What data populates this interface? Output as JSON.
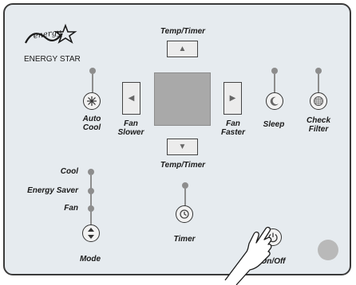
{
  "logo": {
    "text": "ENERGY STAR"
  },
  "buttons": {
    "temp_timer_up_label": "Temp/Timer",
    "temp_timer_down_label": "Temp/Timer",
    "auto_cool_label": "Auto\nCool",
    "fan_slower_label": "Fan\nSlower",
    "fan_faster_label": "Fan\nFaster",
    "sleep_label": "Sleep",
    "check_filter_label": "Check\nFilter",
    "timer_label": "Timer",
    "mode_label": "Mode",
    "on_off_label": "On/Off"
  },
  "mode_options": [
    {
      "label": "Cool"
    },
    {
      "label": "Energy Saver"
    },
    {
      "label": "Fan"
    }
  ],
  "colors": {
    "panel_background": "#e6ebef",
    "panel_border": "#3a3a3a",
    "display": "#a9a9a9",
    "indicator": "#8d8d8d"
  },
  "icons": {
    "temp_up": "triangle-up-icon",
    "temp_down": "triangle-down-icon",
    "fan_slower": "triangle-left-icon",
    "fan_faster": "triangle-right-icon",
    "auto_cool": "snowflake-fan-icon",
    "sleep": "moon-icon",
    "check_filter": "filter-grid-icon",
    "timer": "clock-icon",
    "mode": "up-down-arrows-icon",
    "on_off": "power-icon",
    "pointer": "hand-pointer-icon"
  }
}
